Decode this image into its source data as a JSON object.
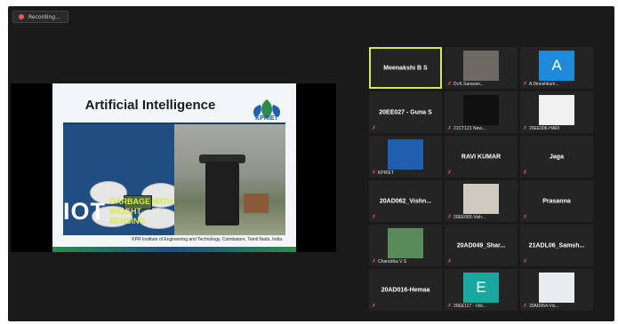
{
  "recording": {
    "label": "Recording..."
  },
  "slide": {
    "title": "Artificial Intelligence",
    "logo_text": "KPRIET",
    "iot_text": "IOT",
    "subtitle_line1": "GARBAGE WITH",
    "subtitle_line2": "WEIGHT SENSING",
    "footer": "KPR Institute of Engineering and Technology, Coimbatore, Tamil Nadu, India"
  },
  "participants": [
    {
      "name": "Meenakshi B S",
      "label": "",
      "active": true,
      "avatar": "none",
      "color": ""
    },
    {
      "name": "",
      "label": "Dr.K.Saravan...",
      "active": false,
      "avatar": "photo",
      "color": "#6d6a63"
    },
    {
      "name": "",
      "label": "A Dineshkum...",
      "active": false,
      "avatar": "letter",
      "letter": "A",
      "color": "#1f8ad7"
    },
    {
      "name": "20EE027 - Guna S",
      "label": "",
      "active": false,
      "avatar": "none",
      "color": ""
    },
    {
      "name": "",
      "label": "21CT121 New...",
      "active": false,
      "avatar": "logo-dark",
      "color": "#101010"
    },
    {
      "name": "",
      "label": "20EE006-HARI",
      "active": false,
      "avatar": "seal",
      "color": "#f0f0f0"
    },
    {
      "name": "",
      "label": "KPRIET",
      "active": false,
      "avatar": "logo-blue",
      "color": "#1f5fae"
    },
    {
      "name": "RAVI KUMAR",
      "label": "",
      "active": false,
      "avatar": "none",
      "color": ""
    },
    {
      "name": "Jaga",
      "label": "",
      "active": false,
      "avatar": "none",
      "color": ""
    },
    {
      "name": "20AD062_Vishn...",
      "label": "",
      "active": false,
      "avatar": "none",
      "color": ""
    },
    {
      "name": "",
      "label": "20EE065-Vish...",
      "active": false,
      "avatar": "photo",
      "color": "#cfc9bf"
    },
    {
      "name": "Prasanna",
      "label": "",
      "active": false,
      "avatar": "none",
      "color": ""
    },
    {
      "name": "",
      "label": "Chandrika V S",
      "active": false,
      "avatar": "photo",
      "color": "#5b8a5a"
    },
    {
      "name": "20AD049_Shar...",
      "label": "",
      "active": false,
      "avatar": "none",
      "color": ""
    },
    {
      "name": "21ADL06_Samsh...",
      "label": "",
      "active": false,
      "avatar": "none",
      "color": ""
    },
    {
      "name": "20AD016-Hemaa",
      "label": "",
      "active": false,
      "avatar": "none",
      "color": ""
    },
    {
      "name": "",
      "label": "20EE117 - Visl...",
      "active": false,
      "avatar": "letter",
      "letter": "E",
      "color": "#1aa7a0"
    },
    {
      "name": "",
      "label": "20AD064-Vis...",
      "active": false,
      "avatar": "photo",
      "color": "#e7ecef"
    }
  ]
}
